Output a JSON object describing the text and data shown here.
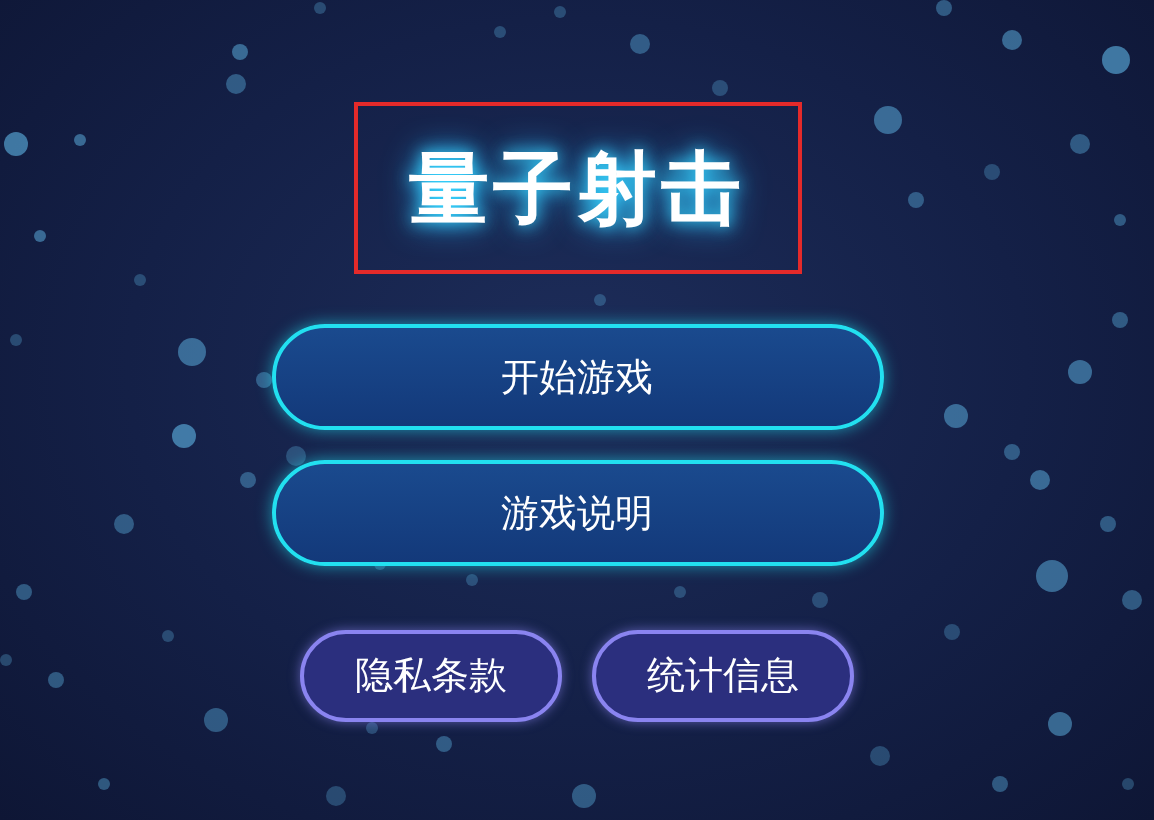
{
  "title": {
    "text": "量子射击",
    "outlined": true
  },
  "primary_buttons": [
    {
      "label": "开始游戏"
    },
    {
      "label": "游戏说明"
    }
  ],
  "secondary_buttons": [
    {
      "label": "隐私条款"
    },
    {
      "label": "统计信息"
    }
  ]
}
